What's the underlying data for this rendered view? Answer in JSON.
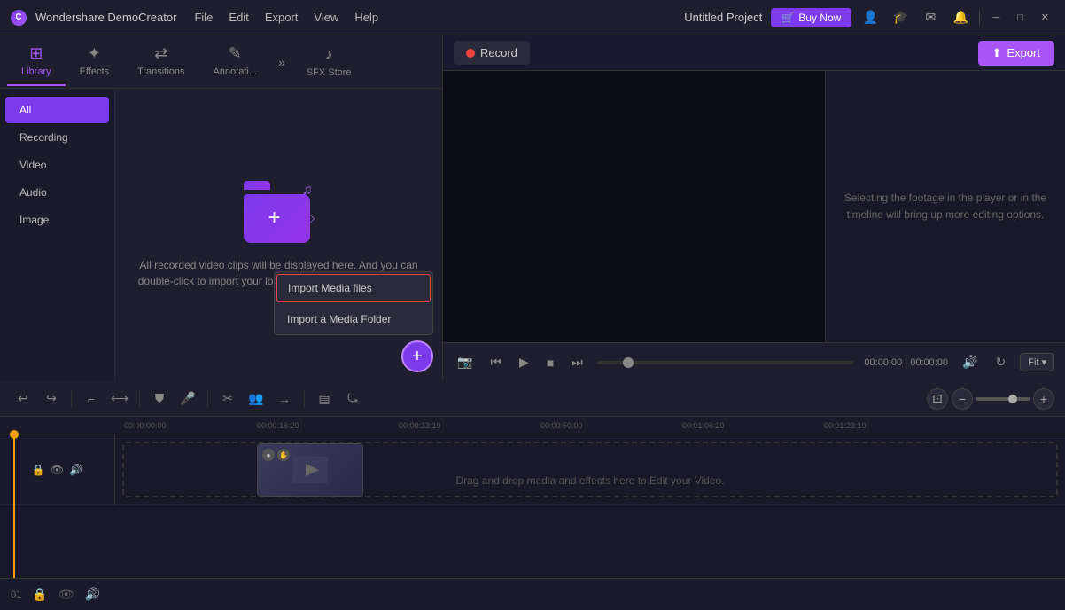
{
  "app": {
    "name": "Wondershare DemoCreator",
    "project": "Untitled Project",
    "logo": "C"
  },
  "titlebar": {
    "menu": [
      "File",
      "Edit",
      "Export",
      "View",
      "Help"
    ],
    "buy_now": "Buy Now",
    "window_controls": [
      "─",
      "□",
      "✕"
    ]
  },
  "tabs": [
    {
      "id": "library",
      "label": "Library",
      "icon": "⊞",
      "active": true
    },
    {
      "id": "effects",
      "label": "Effects",
      "icon": "✦"
    },
    {
      "id": "transitions",
      "label": "Transitions",
      "icon": "⇄"
    },
    {
      "id": "annotations",
      "label": "Annotati...",
      "icon": "✎"
    },
    {
      "id": "sfxstore",
      "label": "SFX Store",
      "icon": "♪"
    }
  ],
  "sidebar": {
    "items": [
      {
        "id": "all",
        "label": "All",
        "active": true
      },
      {
        "id": "recording",
        "label": "Recording"
      },
      {
        "id": "video",
        "label": "Video"
      },
      {
        "id": "audio",
        "label": "Audio"
      },
      {
        "id": "image",
        "label": "Image"
      }
    ]
  },
  "media": {
    "empty_message": "All recorded video clips will be displayed here. And you can double-click to import your local video, image, or audio files."
  },
  "import_dropdown": {
    "items": [
      {
        "id": "import-files",
        "label": "Import Media files",
        "highlighted": true
      },
      {
        "id": "import-folder",
        "label": "Import a Media Folder"
      }
    ]
  },
  "record": {
    "button_label": "Record"
  },
  "export": {
    "button_label": "Export"
  },
  "preview": {
    "side_text": "Selecting the footage in the player or in the timeline will bring up more editing options.",
    "time_current": "00:00:00",
    "time_total": "00:00:00",
    "fit_label": "Fit"
  },
  "toolbar": {
    "buttons": [
      "↩",
      "↪",
      "⌐",
      "⟷",
      "⛊",
      "🎤",
      "⟋",
      "👥",
      "⟿",
      "▤",
      "⤿"
    ]
  },
  "timeline": {
    "rulers": [
      "00:00:00:00",
      "00:00:16:20",
      "00:00:33:10",
      "00:00:50:00",
      "00:01:06:20",
      "00:01:23:10"
    ],
    "drag_drop_msg": "Drag and drop media and effects here to Edit your Video."
  },
  "bottombar": {
    "track_number": "01"
  }
}
